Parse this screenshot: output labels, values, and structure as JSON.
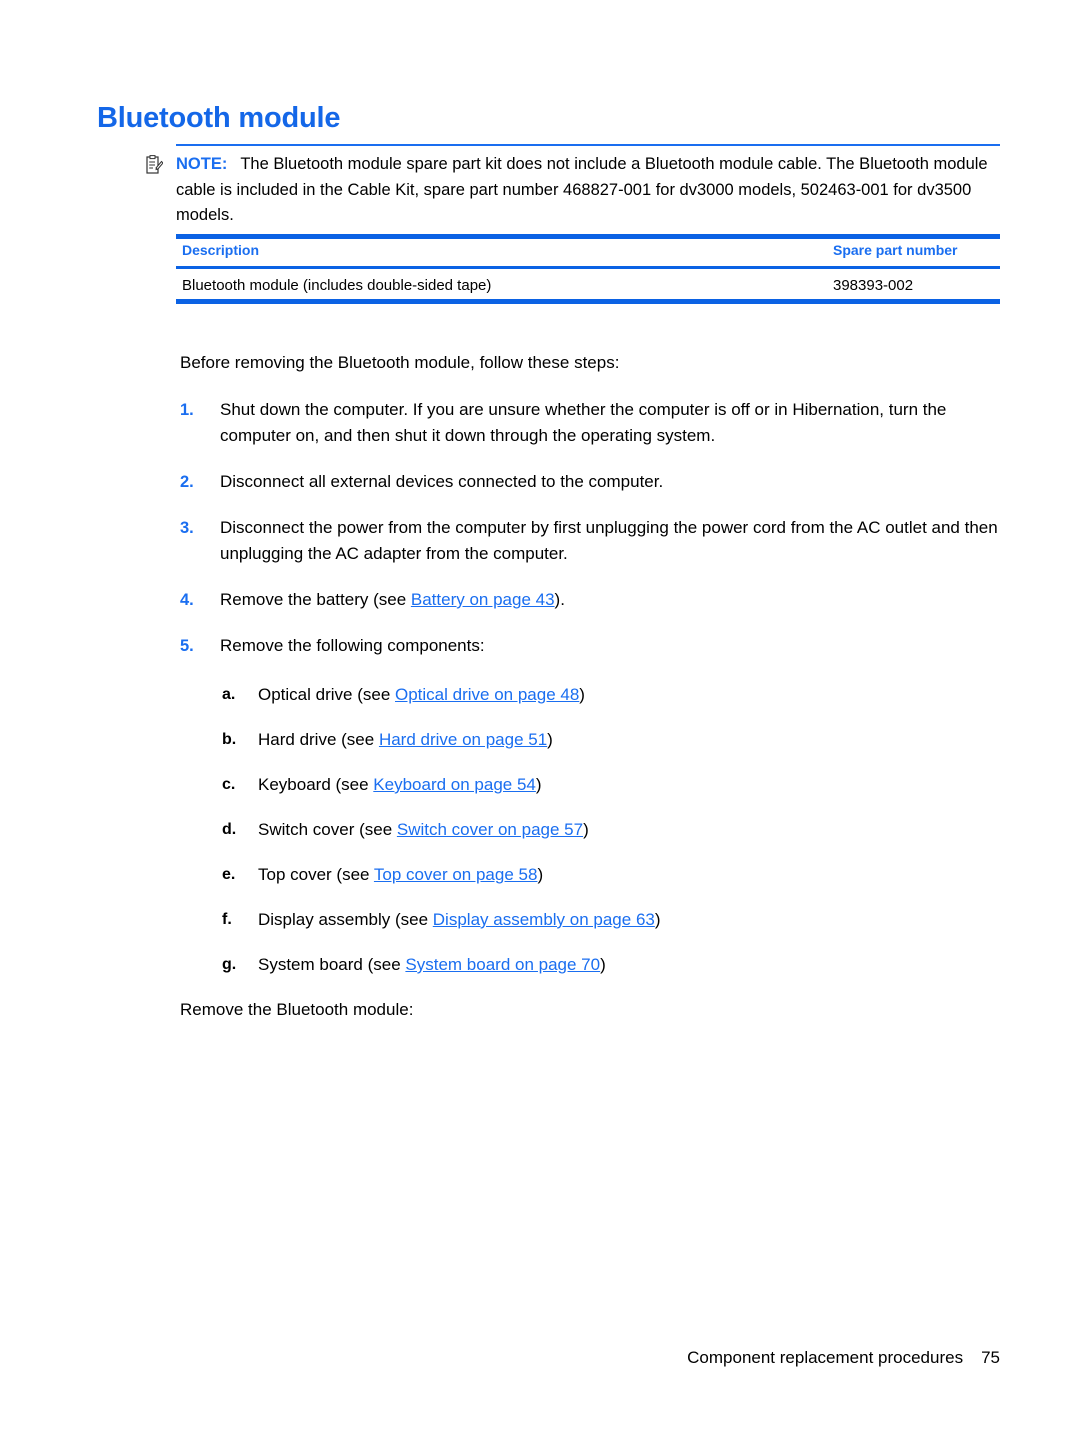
{
  "document": {
    "title": "Bluetooth module"
  },
  "note": {
    "icon": "note-clipboard-icon",
    "label": "NOTE:",
    "text": "The Bluetooth module spare part kit does not include a Bluetooth module cable. The Bluetooth module cable is included in the Cable Kit, spare part number 468827-001 for dv3000 models, 502463-001 for dv3500 models."
  },
  "table": {
    "headers": {
      "description": "Description",
      "spare_part_number": "Spare part number"
    },
    "rows": [
      {
        "description": "Bluetooth module (includes double-sided tape)",
        "spare_part_number": "398393-002"
      }
    ]
  },
  "body": {
    "lead": "Before removing the Bluetooth module, follow these steps:",
    "closing": "Remove the Bluetooth module:",
    "steps": [
      {
        "num": "1.",
        "text": "Shut down the computer. If you are unsure whether the computer is off or in Hibernation, turn the computer on, and then shut it down through the operating system."
      },
      {
        "num": "2.",
        "text": "Disconnect all external devices connected to the computer."
      },
      {
        "num": "3.",
        "text": "Disconnect the power from the computer by first unplugging the power cord from the AC outlet and then unplugging the AC adapter from the computer."
      },
      {
        "num": "4.",
        "prefix": "Remove the battery (see ",
        "link": "Battery on page 43",
        "suffix": ")."
      },
      {
        "num": "5.",
        "text": "Remove the following components:"
      }
    ],
    "substeps": [
      {
        "letter": "a.",
        "prefix": "Optical drive (see ",
        "link": "Optical drive on page 48",
        "suffix": ")"
      },
      {
        "letter": "b.",
        "prefix": "Hard drive (see ",
        "link": "Hard drive on page 51",
        "suffix": ")"
      },
      {
        "letter": "c.",
        "prefix": "Keyboard (see ",
        "link": "Keyboard on page 54",
        "suffix": ")"
      },
      {
        "letter": "d.",
        "prefix": "Switch cover (see ",
        "link": "Switch cover on page 57",
        "suffix": ")"
      },
      {
        "letter": "e.",
        "prefix": "Top cover (see ",
        "link": "Top cover on page 58",
        "suffix": ")"
      },
      {
        "letter": "f.",
        "prefix": "Display assembly (see ",
        "link": "Display assembly on page 63",
        "suffix": ")"
      },
      {
        "letter": "g.",
        "prefix": "System board (see ",
        "link": "System board on page 70",
        "suffix": ")"
      }
    ]
  },
  "footer": {
    "section": "Component replacement procedures",
    "page_number": "75"
  },
  "colors": {
    "accent_blue": "#1a6ef0",
    "rule_blue": "#0b62e4",
    "text_black": "#000000",
    "background": "#ffffff"
  }
}
